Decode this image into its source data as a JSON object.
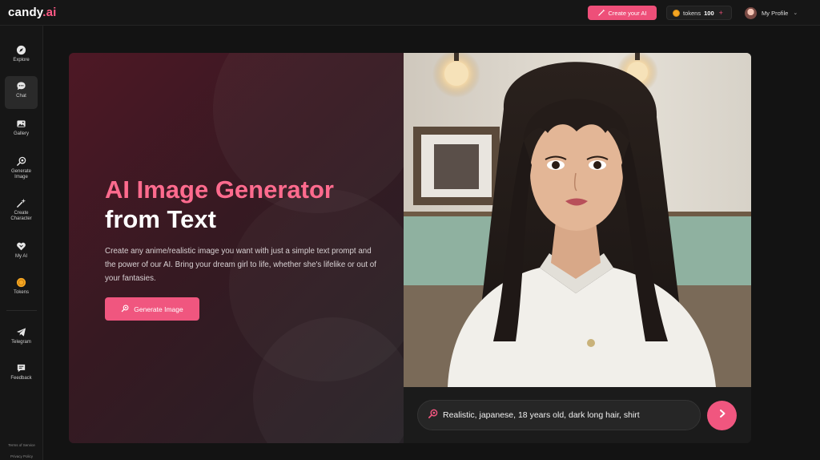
{
  "brand": {
    "name": "candy",
    "suffix": ".ai",
    "accent": "#ff5a86"
  },
  "topbar": {
    "create_ai_label": "Create your AI",
    "tokens_label": "tokens",
    "tokens_count": "100",
    "tokens_plus": "+",
    "profile_label": "My Profile"
  },
  "sidebar": {
    "items": [
      {
        "label": "Explore",
        "icon": "compass-icon"
      },
      {
        "label": "Chat",
        "icon": "chat-bubble-icon",
        "active": true
      },
      {
        "label": "Gallery",
        "icon": "gallery-icon"
      },
      {
        "label": "Generate Image",
        "icon": "generate-image-icon"
      },
      {
        "label": "Create Character",
        "icon": "magic-wand-icon"
      },
      {
        "label": "My AI",
        "icon": "heart-icon"
      },
      {
        "label": "Tokens",
        "icon": "coin-icon"
      },
      {
        "label": "Telegram",
        "icon": "telegram-icon"
      },
      {
        "label": "Feedback",
        "icon": "feedback-icon"
      }
    ],
    "legal": {
      "terms": "Terms of Service",
      "privacy": "Privacy Policy"
    }
  },
  "hero": {
    "title_line1": "AI Image Generator",
    "title_line2": "from Text",
    "description": "Create any anime/realistic image you want with just a simple text prompt and the power of our AI. Bring your dream girl to life, whether she's lifelike or out of your fantasies.",
    "cta_label": "Generate Image",
    "prompt_text": "Realistic, japanese, 18 years old, dark long hair, shirt"
  },
  "colors": {
    "accent": "#f0567f",
    "title_pink": "#ff6b8e",
    "background": "#131313"
  }
}
